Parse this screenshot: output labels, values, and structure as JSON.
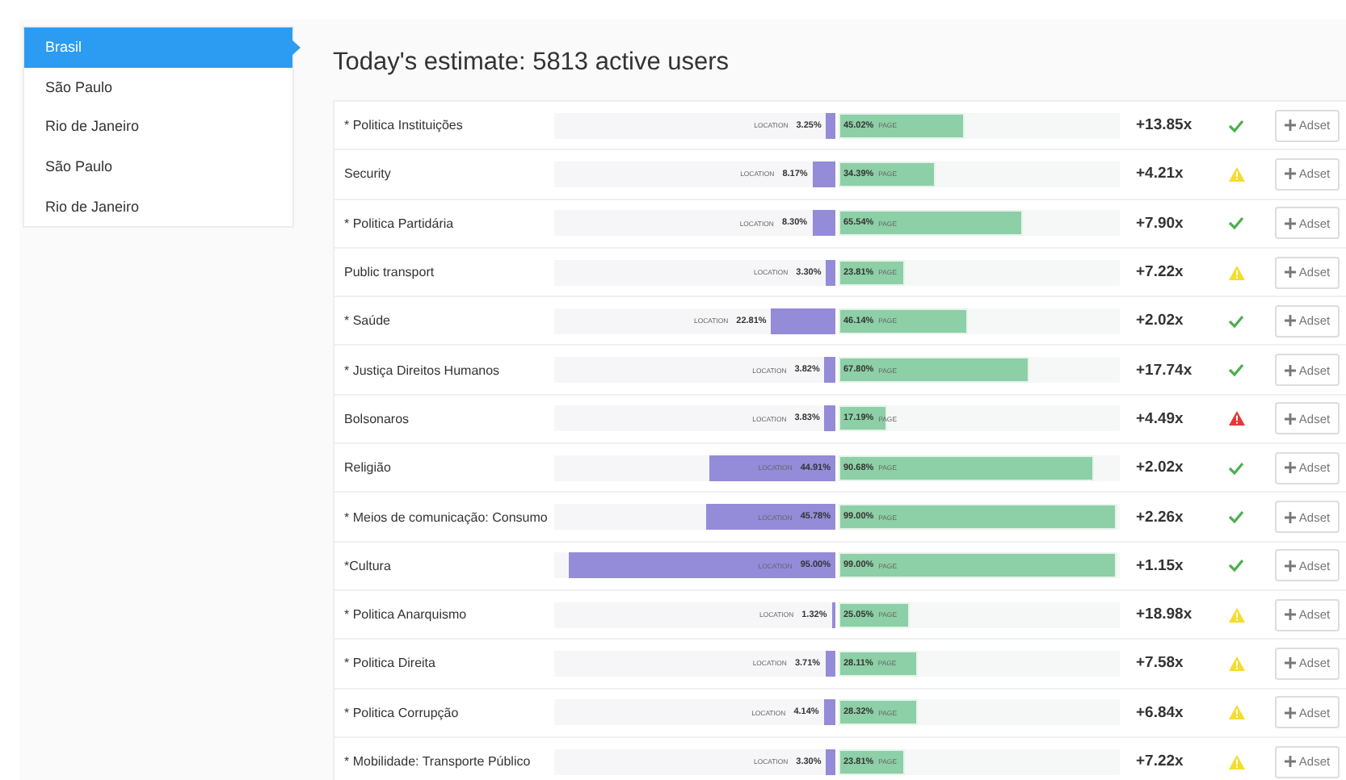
{
  "sidebar": {
    "items": [
      {
        "label": "Brasil",
        "selected": true
      },
      {
        "label": "São Paulo",
        "selected": false
      },
      {
        "label": "Rio de Janeiro",
        "selected": false
      },
      {
        "label": "São Paulo",
        "selected": false
      },
      {
        "label": "Rio de Janeiro",
        "selected": false
      }
    ]
  },
  "title": "Today's estimate: 5813 active users",
  "rows": [
    {
      "name": "* Politica Instituições",
      "location": {
        "label": "LOCATION",
        "value": "3.25%",
        "level": 0.0325
      },
      "page": {
        "value": "45.02%",
        "label": "PAGE",
        "level": 0.4502
      },
      "multiplier": "+13.85x",
      "status": {
        "kind": "ok"
      },
      "button": "Adset"
    },
    {
      "name": "Security",
      "location": {
        "label": "LOCATION",
        "value": "8.17%",
        "level": 0.0817
      },
      "page": {
        "value": "34.39%",
        "label": "PAGE",
        "level": 0.3439
      },
      "multiplier": "+4.21x",
      "status": {
        "kind": "warning"
      },
      "button": "Adset"
    },
    {
      "name": "* Politica Partidária",
      "location": {
        "label": "LOCATION",
        "value": "8.30%",
        "level": 0.083
      },
      "page": {
        "value": "65.54%",
        "label": "PAGE",
        "level": 0.6554
      },
      "multiplier": "+7.90x",
      "status": {
        "kind": "ok"
      },
      "button": "Adset"
    },
    {
      "name": "Public transport",
      "location": {
        "label": "LOCATION",
        "value": "3.30%",
        "level": 0.033
      },
      "page": {
        "value": "23.81%",
        "label": "PAGE",
        "level": 0.2381
      },
      "multiplier": "+7.22x",
      "status": {
        "kind": "warning"
      },
      "button": "Adset"
    },
    {
      "name": "* Saúde",
      "location": {
        "label": "LOCATION",
        "value": "22.81%",
        "level": 0.2281
      },
      "page": {
        "value": "46.14%",
        "label": "PAGE",
        "level": 0.4614
      },
      "multiplier": "+2.02x",
      "status": {
        "kind": "ok"
      },
      "button": "Adset"
    },
    {
      "name": "* Justiça Direitos Humanos",
      "location": {
        "label": "LOCATION",
        "value": "3.82%",
        "level": 0.0382
      },
      "page": {
        "value": "67.80%",
        "label": "PAGE",
        "level": 0.678
      },
      "multiplier": "+17.74x",
      "status": {
        "kind": "ok"
      },
      "button": "Adset"
    },
    {
      "name": "Bolsonaros",
      "location": {
        "label": "LOCATION",
        "value": "3.83%",
        "level": 0.0383
      },
      "page": {
        "value": "17.19%",
        "label": "PAGE",
        "level": 0.1719
      },
      "multiplier": "+4.49x",
      "status": {
        "kind": "alert"
      },
      "button": "Adset"
    },
    {
      "name": "Religião",
      "location": {
        "label": "LOCATION",
        "value": "44.91%",
        "level": 0.4491
      },
      "page": {
        "value": "90.68%",
        "label": "PAGE",
        "level": 0.9068
      },
      "multiplier": "+2.02x",
      "status": {
        "kind": "ok"
      },
      "button": "Adset"
    },
    {
      "name": "* Meios de comunicação: Consumo",
      "location": {
        "label": "LOCATION",
        "value": "45.78%",
        "level": 0.4578
      },
      "page": {
        "value": "99.00%",
        "label": "PAGE",
        "level": 0.99
      },
      "multiplier": "+2.26x",
      "status": {
        "kind": "ok"
      },
      "button": "Adset"
    },
    {
      "name": "*Cultura",
      "location": {
        "label": "LOCATION",
        "value": "95.00%",
        "level": 0.95
      },
      "page": {
        "value": "99.00%",
        "label": "PAGE",
        "level": 0.99
      },
      "multiplier": "+1.15x",
      "status": {
        "kind": "ok"
      },
      "button": "Adset"
    },
    {
      "name": "* Politica Anarquismo",
      "location": {
        "label": "LOCATION",
        "value": "1.32%",
        "level": 0.0132
      },
      "page": {
        "value": "25.05%",
        "label": "PAGE",
        "level": 0.2505
      },
      "multiplier": "+18.98x",
      "status": {
        "kind": "warning"
      },
      "button": "Adset"
    },
    {
      "name": "* Politica Direita",
      "location": {
        "label": "LOCATION",
        "value": "3.71%",
        "level": 0.0371
      },
      "page": {
        "value": "28.11%",
        "label": "PAGE",
        "level": 0.2811
      },
      "multiplier": "+7.58x",
      "status": {
        "kind": "warning"
      },
      "button": "Adset"
    },
    {
      "name": "* Politica Corrupção",
      "location": {
        "label": "LOCATION",
        "value": "4.14%",
        "level": 0.0414
      },
      "page": {
        "value": "28.32%",
        "label": "PAGE",
        "level": 0.2832
      },
      "multiplier": "+6.84x",
      "status": {
        "kind": "warning"
      },
      "button": "Adset"
    },
    {
      "name": "* Mobilidade: Transporte Público",
      "location": {
        "label": "LOCATION",
        "value": "3.30%",
        "level": 0.033
      },
      "page": {
        "value": "23.81%",
        "label": "PAGE",
        "level": 0.2381
      },
      "multiplier": "+7.22x",
      "status": {
        "kind": "warning"
      },
      "button": "Adset"
    }
  ]
}
